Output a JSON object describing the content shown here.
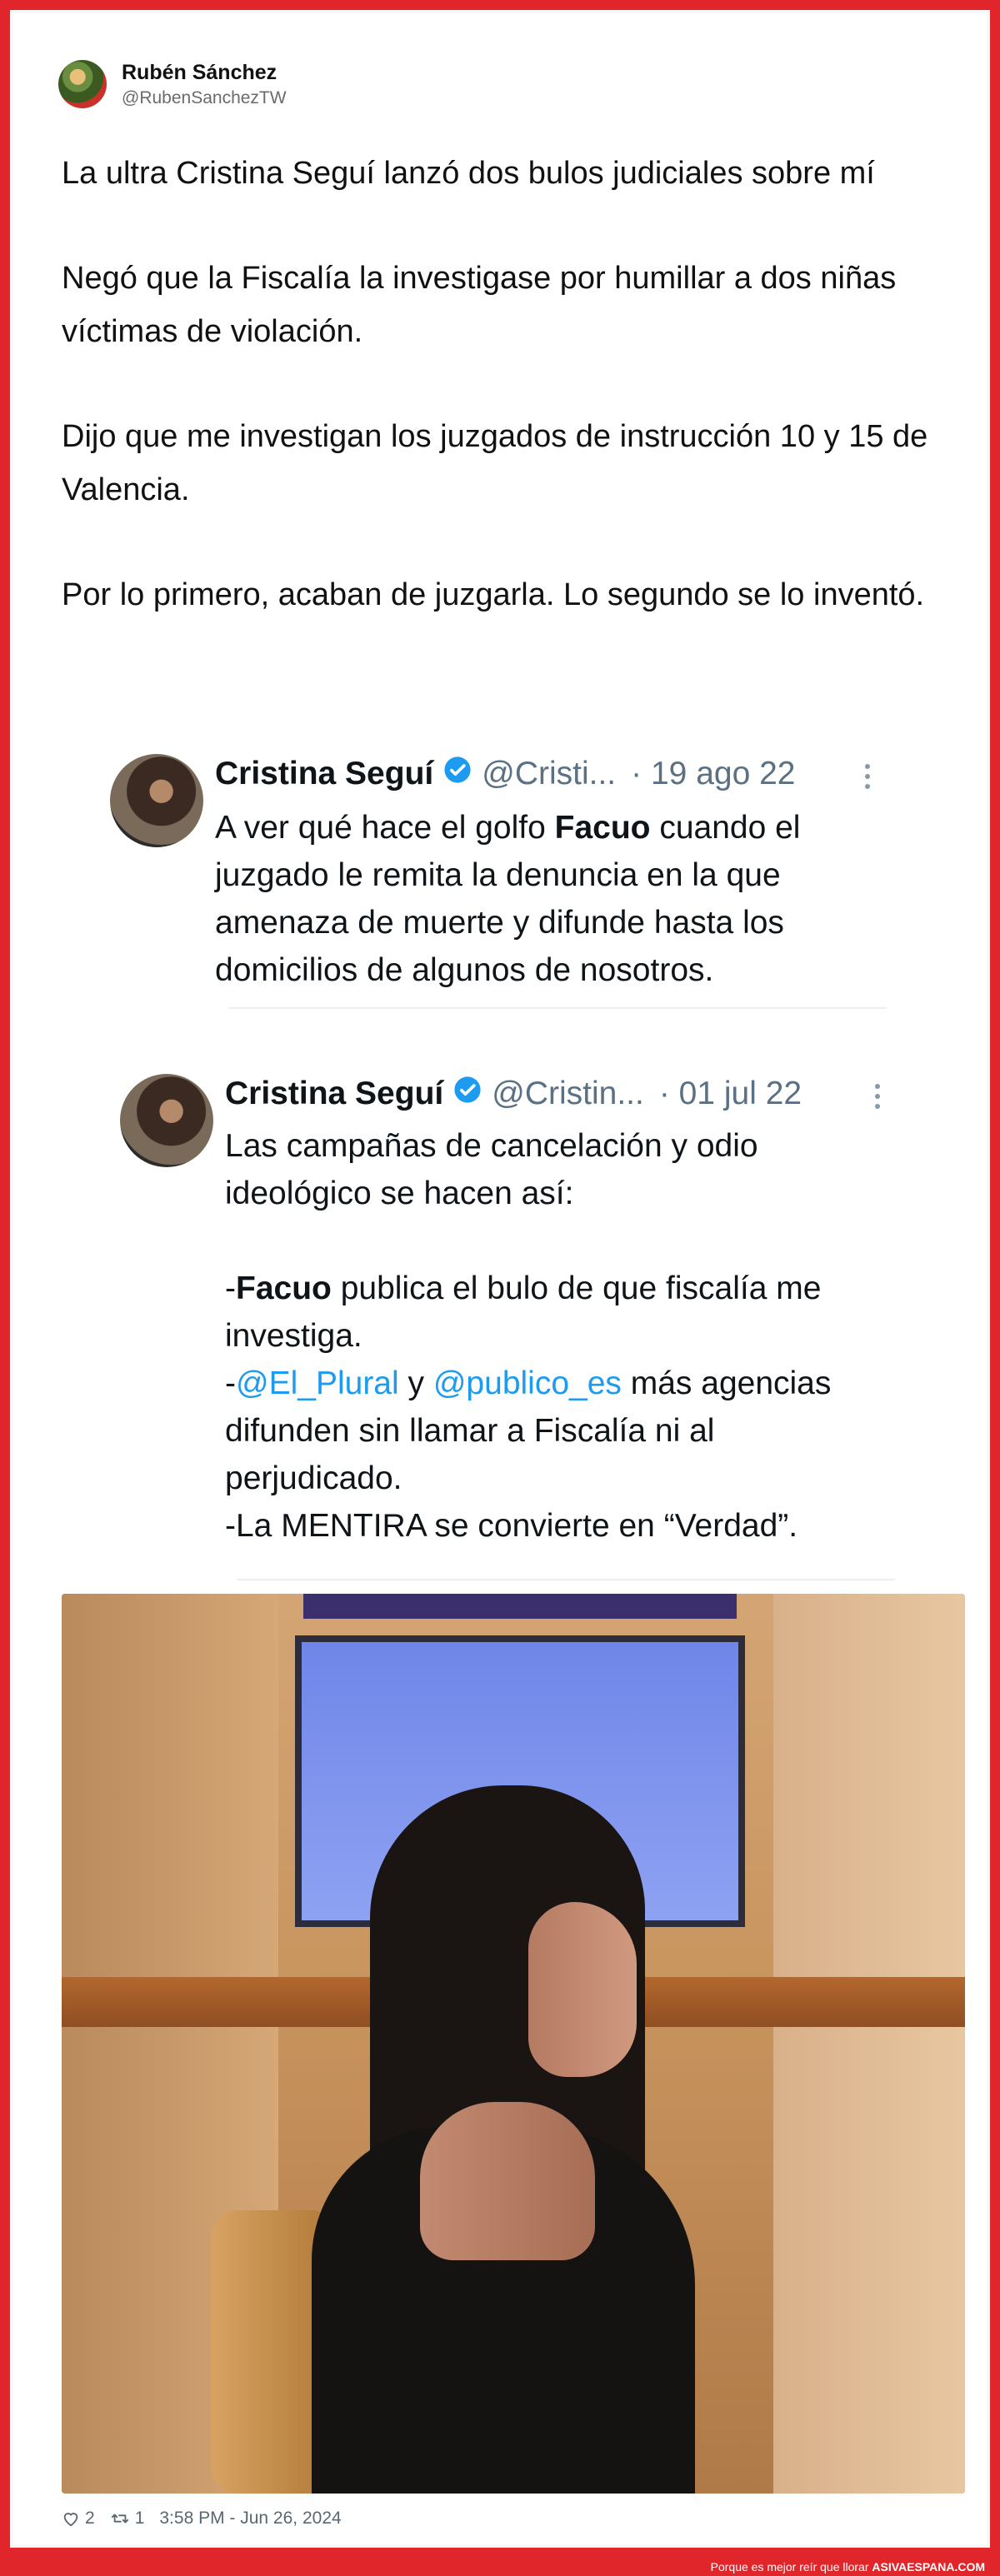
{
  "author": {
    "name": "Rubén Sánchez",
    "handle": "@RubenSanchezTW"
  },
  "tweet": {
    "paragraphs": [
      "La ultra Cristina Seguí lanzó dos bulos judiciales sobre mí",
      "Negó que la Fiscalía la investigase por humillar a dos niñas víctimas de violación.",
      "Dijo que me investigan los juzgados de instrucción 10 y 15 de Valencia.",
      "Por lo primero, acaban de juzgarla. Lo segundo se lo inventó."
    ]
  },
  "quoted": [
    {
      "name": "Cristina Seguí",
      "handle": "@Cristi...",
      "date": "· 19 ago 22",
      "text_parts": [
        "A ver qué hace el golfo ",
        "Facuo",
        " cuando el juzgado le remita la denuncia en la que amenaza de muerte y difunde hasta los domicilios de algunos de nosotros."
      ]
    },
    {
      "name": "Cristina Seguí",
      "handle": "@Cristin...",
      "date": "· 01 jul 22",
      "line1": "Las campañas de cancelación y odio ideológico se hacen así:",
      "line2_prefix": "-",
      "line2_bold": "Facuo",
      "line2_rest": " publica el bulo de que fiscalía me investiga.",
      "line3_prefix": "-",
      "mention1": "@El_Plural",
      "line3_mid": " y ",
      "mention2": "@publico_es",
      "line3_rest": " más agencias difunden sin llamar a Fiscalía ni al perjudicado.",
      "line4": "-La MENTIRA se convierte en “Verdad”."
    }
  ],
  "stats": {
    "likes": "2",
    "retweets": "1",
    "timestamp": "3:58 PM - Jun 26, 2024"
  },
  "footer_banner": {
    "text": "Porque es mejor reír que llorar",
    "site": "ASIVAESPANA.COM"
  },
  "colors": {
    "frame": "#e0262b",
    "mention": "#1d9bf0",
    "verified": "#1d9bf0"
  },
  "icons": [
    "heart-icon",
    "retweet-icon",
    "verified-icon",
    "more-icon"
  ]
}
